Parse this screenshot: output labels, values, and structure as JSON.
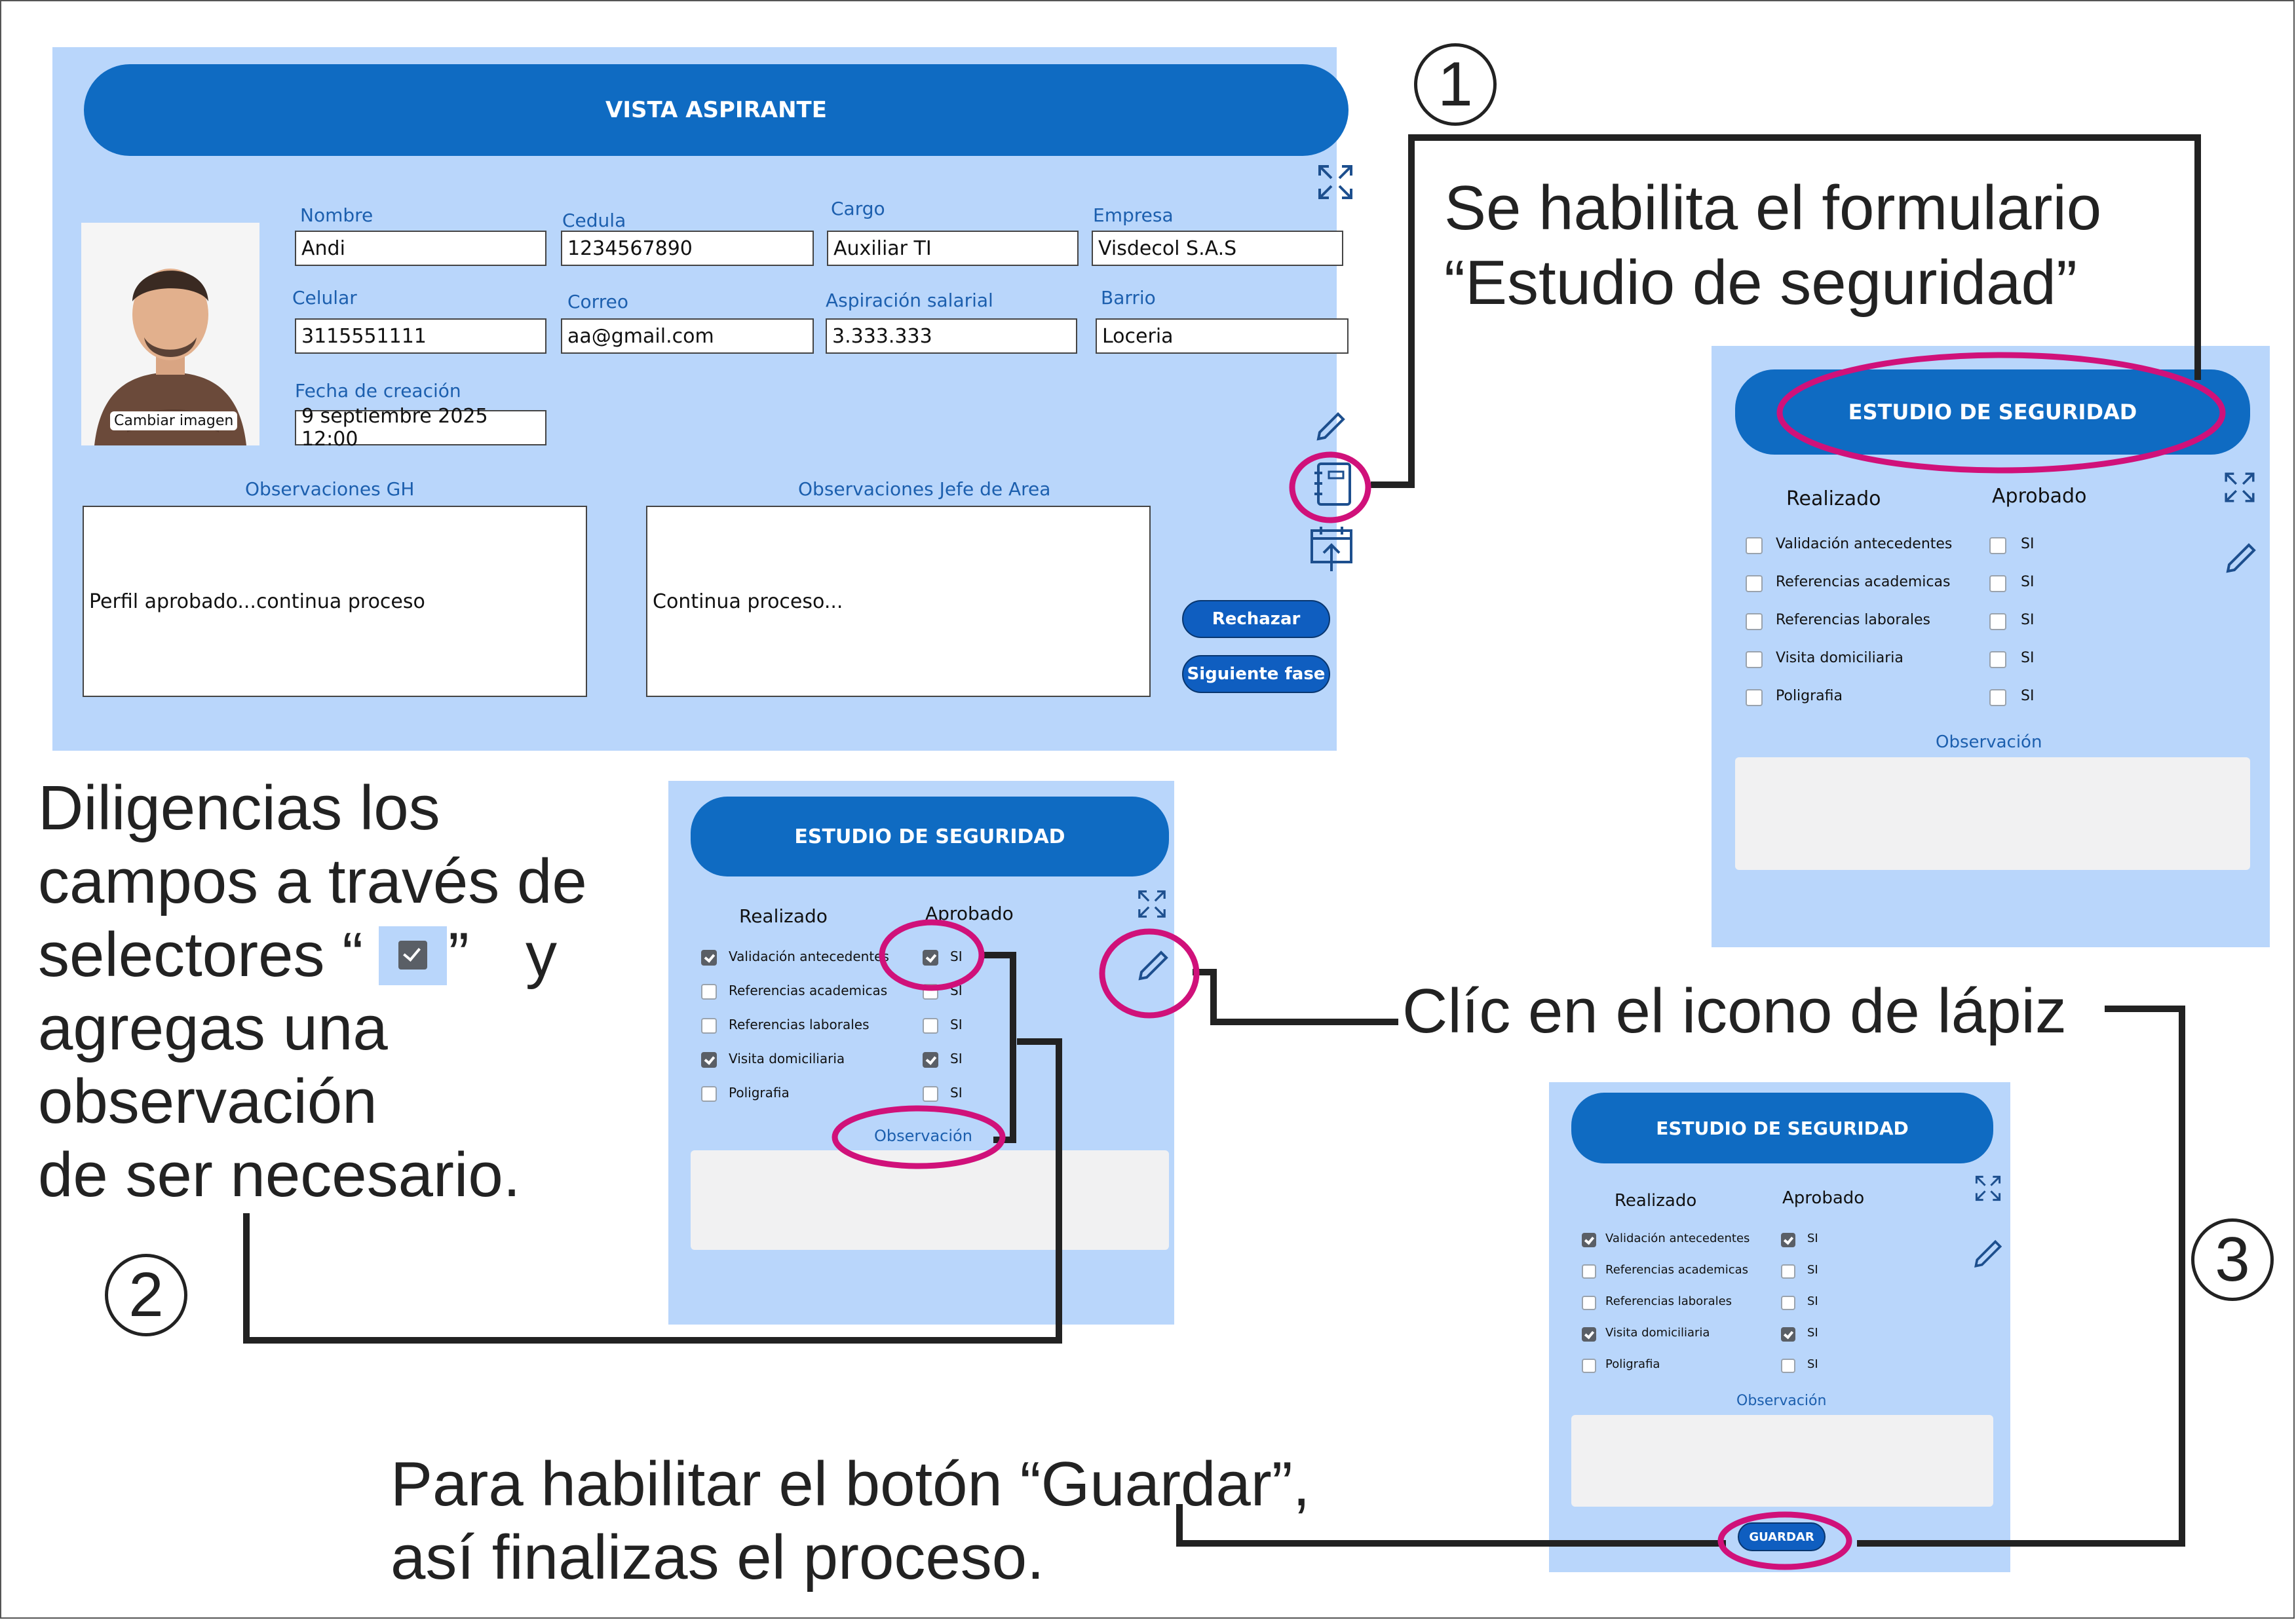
{
  "vista": {
    "title": "VISTA ASPIRANTE",
    "fields": {
      "nombre": {
        "label": "Nombre",
        "value": "Andi"
      },
      "cedula": {
        "label": "Cedula",
        "value": "1234567890"
      },
      "cargo": {
        "label": "Cargo",
        "value": "Auxiliar TI"
      },
      "empresa": {
        "label": "Empresa",
        "value": "Visdecol S.A.S"
      },
      "celular": {
        "label": "Celular",
        "value": "3115551111"
      },
      "correo": {
        "label": "Correo",
        "value": "aa@gmail.com"
      },
      "aspiracion": {
        "label": "Aspiración salarial",
        "value": "3.333.333"
      },
      "barrio": {
        "label": "Barrio",
        "value": "Loceria"
      },
      "fecha": {
        "label": "Fecha de creación",
        "value": "9 septiembre 2025 12:00"
      }
    },
    "change_image": "Cambiar imagen",
    "obs_gh": {
      "label": "Observaciones GH",
      "value": "Perfil aprobado...continua proceso"
    },
    "obs_jefe": {
      "label": "Observaciones Jefe de Area",
      "value": "Continua proceso..."
    },
    "reject_button": "Rechazar",
    "next_button": "Siguiente fase"
  },
  "estudio": {
    "title": "ESTUDIO DE SEGURIDAD",
    "col_realizado": "Realizado",
    "col_aprobado": "Aprobado",
    "items": [
      "Validación antecedentes",
      "Referencias academicas",
      "Referencias laborales",
      "Visita domiciliaria",
      "Poligrafia"
    ],
    "si": "SI",
    "observacion": "Observación",
    "save_button": "GUARDAR"
  },
  "panels": {
    "p1_checked": [
      false,
      false,
      false,
      false,
      false
    ],
    "p2_checked": [
      true,
      false,
      false,
      true,
      false
    ],
    "p3_checked": [
      true,
      false,
      false,
      true,
      false
    ]
  },
  "annotations": {
    "step1_number": "1",
    "step1_text_l1": "Se habilita el formulario",
    "step1_text_l2": "“Estudio de seguridad”",
    "step2_number": "2",
    "step2_l1": "Diligencias los",
    "step2_l2": "campos a través de",
    "step2_l3a": "selectores “",
    "step2_l3b": "”",
    "step2_l3c": "y",
    "step2_l4": "agregas una",
    "step2_l5": "observación",
    "step2_l6": "de ser necesario.",
    "pencil_text": "Clíc en el icono de lápiz",
    "step3_number": "3",
    "step3_l1": "Para habilitar el botón “Guardar”,",
    "step3_l2": "así finalizas el proceso."
  },
  "colors": {
    "panel_bg": "#b9d6fb",
    "banner": "#0f6bc2",
    "highlight": "#d0117a",
    "connector": "#222222"
  }
}
